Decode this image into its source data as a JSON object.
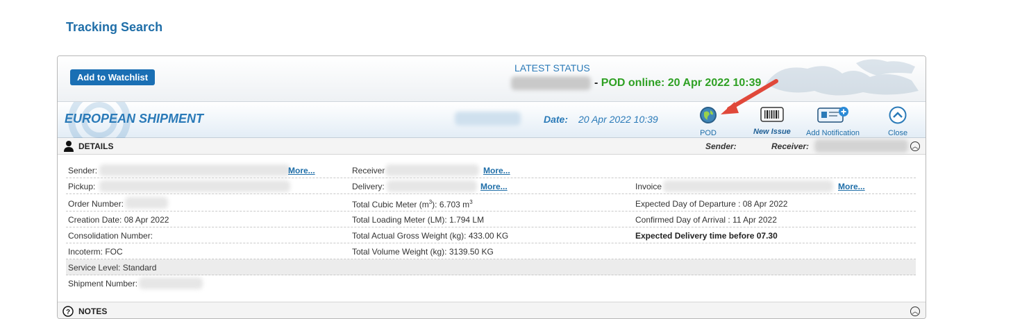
{
  "page_title": "Tracking Search",
  "status": {
    "add_watchlist": "Add to Watchlist",
    "latest_label": "LATEST STATUS",
    "dash": "-",
    "pod_online": "POD online: 20 Apr 2022 10:39"
  },
  "shipment": {
    "title": "EUROPEAN SHIPMENT",
    "date_label": "Date:",
    "date_value": "20 Apr 2022 10:39",
    "tools": {
      "pod": "POD",
      "new_issue": "New Issue",
      "add_notification": "Add Notification",
      "close": "Close"
    }
  },
  "details": {
    "title": "DETAILS",
    "sender_label": "Sender:",
    "receiver_label": "Receiver:",
    "more": "More...",
    "rows": {
      "sender": "Sender:",
      "receiver": "Receiver",
      "pickup": "Pickup:",
      "delivery": "Delivery:",
      "invoice": "Invoice",
      "order_number": "Order Number:",
      "total_cubic_meter_label": "Total Cubic Meter (m",
      "total_cubic_meter_sup": "3",
      "total_cubic_meter_value": "):  6.703  m",
      "total_cubic_meter_unit_sup": "3",
      "expected_departure": "Expected Day of Departure :  08 Apr 2022",
      "creation_date": "Creation Date:  08 Apr 2022",
      "total_loading_meter": "Total Loading Meter (LM):  1.794  LM",
      "confirmed_arrival": "Confirmed Day of Arrival :  11 Apr 2022",
      "consolidation_number": "Consolidation Number:",
      "total_gross_weight": "Total Actual Gross Weight (kg):  433.00  KG",
      "expected_delivery": "Expected Delivery time before 07.30",
      "incoterm": "Incoterm: FOC",
      "total_volume_weight": "Total Volume Weight (kg):  3139.50  KG",
      "service_level": "Service Level: Standard",
      "shipment_number": "Shipment Number:"
    }
  },
  "notes": {
    "title": "NOTES"
  },
  "colors": {
    "accent_blue": "#1f6ea8",
    "button_blue": "#1a6fb4",
    "pod_green": "#2ea023",
    "arrow_red": "#e0483a"
  },
  "icons": [
    "user-icon",
    "globe-icon",
    "barcode-icon",
    "notification-card-icon",
    "chevron-up-icon",
    "help-icon",
    "collapse-icon"
  ]
}
